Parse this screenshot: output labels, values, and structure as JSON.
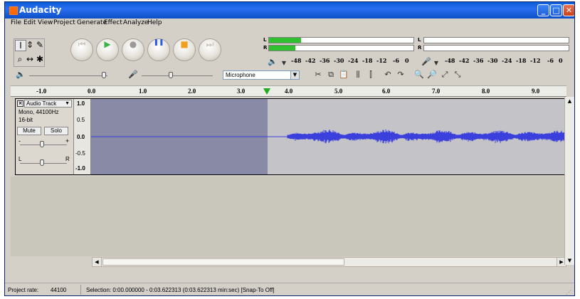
{
  "window": {
    "title": "Audacity",
    "minimize": "_",
    "maximize": "□",
    "close": "✕"
  },
  "menu": [
    "File",
    "Edit",
    "View",
    "Project",
    "Generate",
    "Effect",
    "Analyze",
    "Help"
  ],
  "tools": [
    {
      "name": "selection-tool",
      "glyph": "I"
    },
    {
      "name": "envelope-tool",
      "glyph": "⇕"
    },
    {
      "name": "draw-tool",
      "glyph": "✎"
    },
    {
      "name": "zoom-tool",
      "glyph": "⌕"
    },
    {
      "name": "timeshift-tool",
      "glyph": "↔"
    },
    {
      "name": "multi-tool",
      "glyph": "✱"
    }
  ],
  "transport": [
    {
      "name": "skip-start",
      "glyph": "⏮",
      "color": "#c9c4ba"
    },
    {
      "name": "play",
      "glyph": "▶",
      "color": "#3bb44a"
    },
    {
      "name": "record",
      "glyph": "●",
      "color": "#9a9a9a"
    },
    {
      "name": "pause",
      "glyph": "❚❚",
      "color": "#2a5ae0"
    },
    {
      "name": "stop",
      "glyph": "■",
      "color": "#f0a020"
    },
    {
      "name": "skip-end",
      "glyph": "⏭",
      "color": "#c9c4ba"
    }
  ],
  "meters": {
    "play": {
      "left_level": 0.22,
      "right_level": 0.18,
      "L": "L",
      "R": "R"
    },
    "record": {
      "L": "L",
      "R": "R"
    }
  },
  "meter_scale": [
    "-48",
    "-42",
    "-36",
    "-30",
    "-24",
    "-18",
    "-12",
    "-6",
    "0"
  ],
  "mixer": {
    "input_source": "Microphone",
    "speaker_icon": "speaker-icon",
    "mic_icon": "microphone-icon"
  },
  "ruler": [
    "-1.0",
    "0.0",
    "1.0",
    "2.0",
    "3.0",
    "4.0",
    "5.0",
    "6.0",
    "7.0",
    "8.0",
    "9.0"
  ],
  "track": {
    "name": "Audio Track",
    "info1": "Mono, 44100Hz",
    "info2": "16-bit",
    "mute": "Mute",
    "solo": "Solo",
    "gain_minus": "-",
    "gain_plus": "+",
    "pan_left": "L",
    "pan_right": "R",
    "scale": [
      "1.0",
      "0.5",
      "0.0",
      "-0.5",
      "-1.0"
    ],
    "wave_color": "#3b3fdc",
    "selection_color": "#888aa6"
  },
  "status": {
    "rate_label": "Project rate:",
    "rate_value": "44100",
    "selection": "Selection: 0:00.000000 - 0:03.622313 (0:03.622313 min:sec)  [Snap-To Off]"
  }
}
